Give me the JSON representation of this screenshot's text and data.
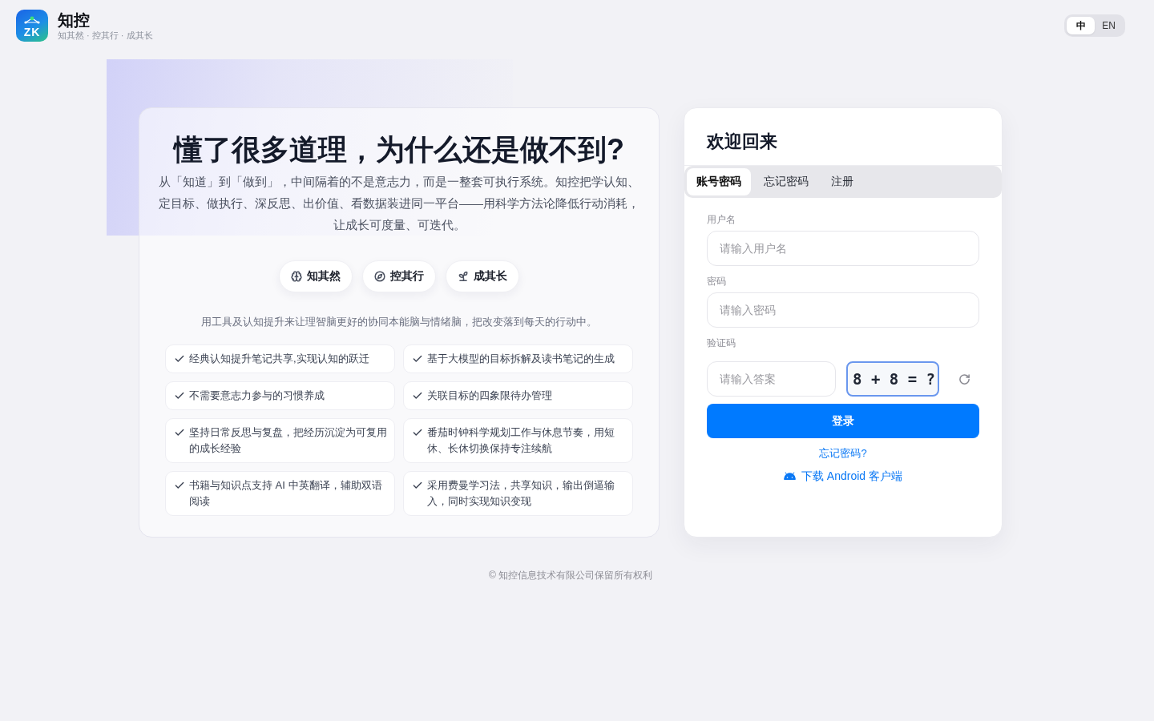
{
  "header": {
    "logo_text": "ZK",
    "app_name": "知控",
    "slogan": "知其然 · 控其行 · 成其长",
    "languages": [
      {
        "label": "中",
        "selected": true
      },
      {
        "label": "EN",
        "selected": false
      }
    ]
  },
  "intro": {
    "title": "懂了很多道理，为什么还是做不到?",
    "description": "从「知道」到「做到」，中间隔着的不是意志力，而是一整套可执行系统。知控把学认知、定目标、做执行、深反思、出价值、看数据装进同一平台——用科学方法论降低行动消耗，让成长可度量、可迭代。",
    "pillars": [
      {
        "kind": "brain",
        "label": "知其然"
      },
      {
        "kind": "compass",
        "label": "控其行"
      },
      {
        "kind": "sprout",
        "label": "成其长"
      }
    ],
    "tagline": "用工具及认知提升来让理智脑更好的协同本能脑与情绪脑，把改变落到每天的行动中。",
    "features": [
      "经典认知提升笔记共享,实现认知的跃迁",
      "基于大模型的目标拆解及读书笔记的生成",
      "不需要意志力参与的习惯养成",
      "关联目标的四象限待办管理",
      "坚持日常反思与复盘，把经历沉淀为可复用的成长经验",
      "番茄时钟科学规划工作与休息节奏，用短休、长休切换保持专注续航",
      "书籍与知识点支持 AI 中英翻译，辅助双语阅读",
      "采用费曼学习法，共享知识，输出倒逼输入，同时实现知识变现"
    ]
  },
  "login": {
    "title": "欢迎回来",
    "tabs": [
      {
        "label": "账号密码",
        "selected": true
      },
      {
        "label": "忘记密码",
        "selected": false
      },
      {
        "label": "注册",
        "selected": false
      }
    ],
    "fields": [
      {
        "kind": "text",
        "label": "用户名",
        "placeholder": "请输入用户名"
      },
      {
        "kind": "password",
        "label": "密码",
        "placeholder": "请输入密码"
      },
      {
        "kind": "captcha",
        "label": "验证码",
        "placeholder": "请输入答案",
        "challenge": "8 + 8 = ?"
      }
    ],
    "submit": "登录",
    "forgot_link": "忘记密码?",
    "download_link": "下载 Android 客户端"
  },
  "footer": "© 知控信息技术有限公司保留所有权利"
}
